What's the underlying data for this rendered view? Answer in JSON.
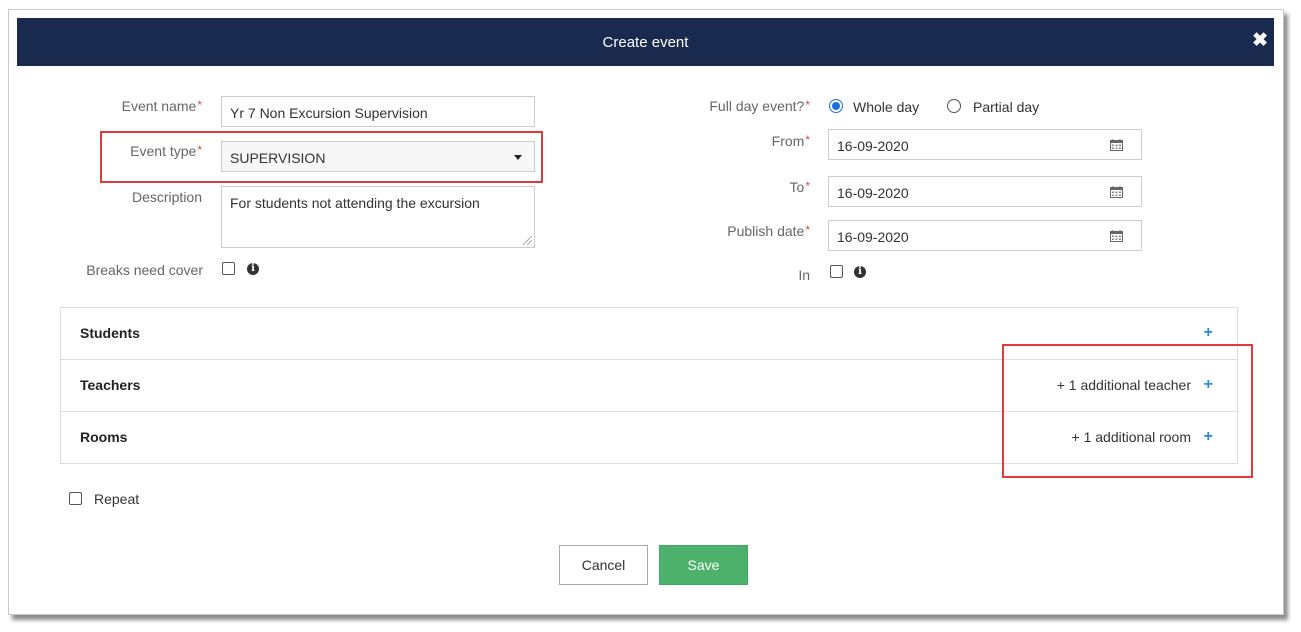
{
  "dialog": {
    "title": "Create event",
    "close_icon": "close-icon"
  },
  "left_form": {
    "event_name_label": "Event name",
    "event_name_value": "Yr 7 Non Excursion Supervision",
    "event_type_label": "Event type",
    "event_type_value": "SUPERVISION",
    "description_label": "Description",
    "description_value": "For students not attending the excursion",
    "breaks_label": "Breaks need cover",
    "required_marker": "*"
  },
  "right_form": {
    "full_day_label": "Full day event?",
    "whole_day_label": "Whole day",
    "partial_day_label": "Partial day",
    "from_label": "From",
    "from_value": "16-09-2020",
    "to_label": "To",
    "to_value": "16-09-2020",
    "publish_label": "Publish date",
    "publish_value": "16-09-2020",
    "in_label": "In"
  },
  "panels": {
    "students_title": "Students",
    "teachers_title": "Teachers",
    "teachers_extra": "+ 1 additional teacher",
    "rooms_title": "Rooms",
    "rooms_extra": "+ 1 additional room",
    "plus_symbol": "+"
  },
  "repeat_label": "Repeat",
  "buttons": {
    "cancel": "Cancel",
    "save": "Save"
  },
  "colors": {
    "header_bg": "#1a2a4e",
    "save_bg": "#4cb16a",
    "highlight": "#e03a3a",
    "radio_accent": "#1a6fe0",
    "plus": "#2d8ad4"
  }
}
